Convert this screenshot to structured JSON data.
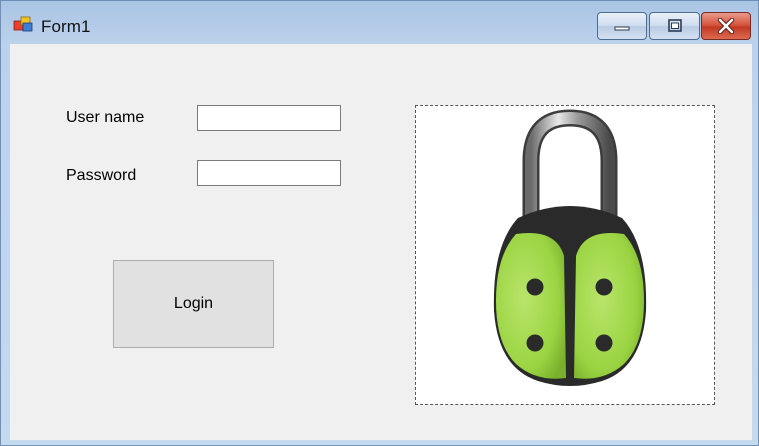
{
  "window": {
    "title": "Form1",
    "icon": "winforms-app-icon",
    "controls": [
      "minimize-icon",
      "maximize-icon",
      "close-icon"
    ]
  },
  "form": {
    "username_label": "User name",
    "username_value": "",
    "password_label": "Password",
    "password_value": "",
    "login_label": "Login",
    "picture": "green-ladybug-padlock-image"
  }
}
